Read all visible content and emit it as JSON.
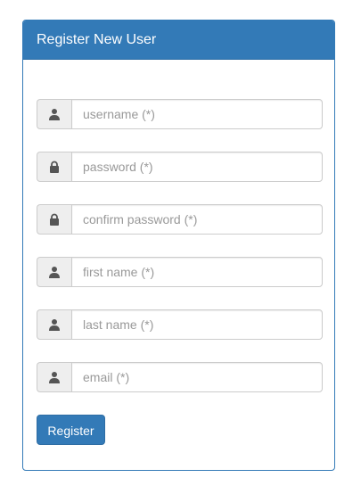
{
  "panel": {
    "title": "Register New User"
  },
  "form": {
    "fields": [
      {
        "icon": "user-icon",
        "placeholder": "username (*)",
        "value": ""
      },
      {
        "icon": "lock-icon",
        "placeholder": "password (*)",
        "value": ""
      },
      {
        "icon": "lock-icon",
        "placeholder": "confirm password (*)",
        "value": ""
      },
      {
        "icon": "user-icon",
        "placeholder": "first name (*)",
        "value": ""
      },
      {
        "icon": "user-icon",
        "placeholder": "last name (*)",
        "value": ""
      },
      {
        "icon": "user-icon",
        "placeholder": "email (*)",
        "value": ""
      }
    ],
    "submit_label": "Register"
  },
  "colors": {
    "primary": "#337ab7",
    "addon_bg": "#eeeeee",
    "border": "#cccccc",
    "placeholder": "#999999"
  }
}
